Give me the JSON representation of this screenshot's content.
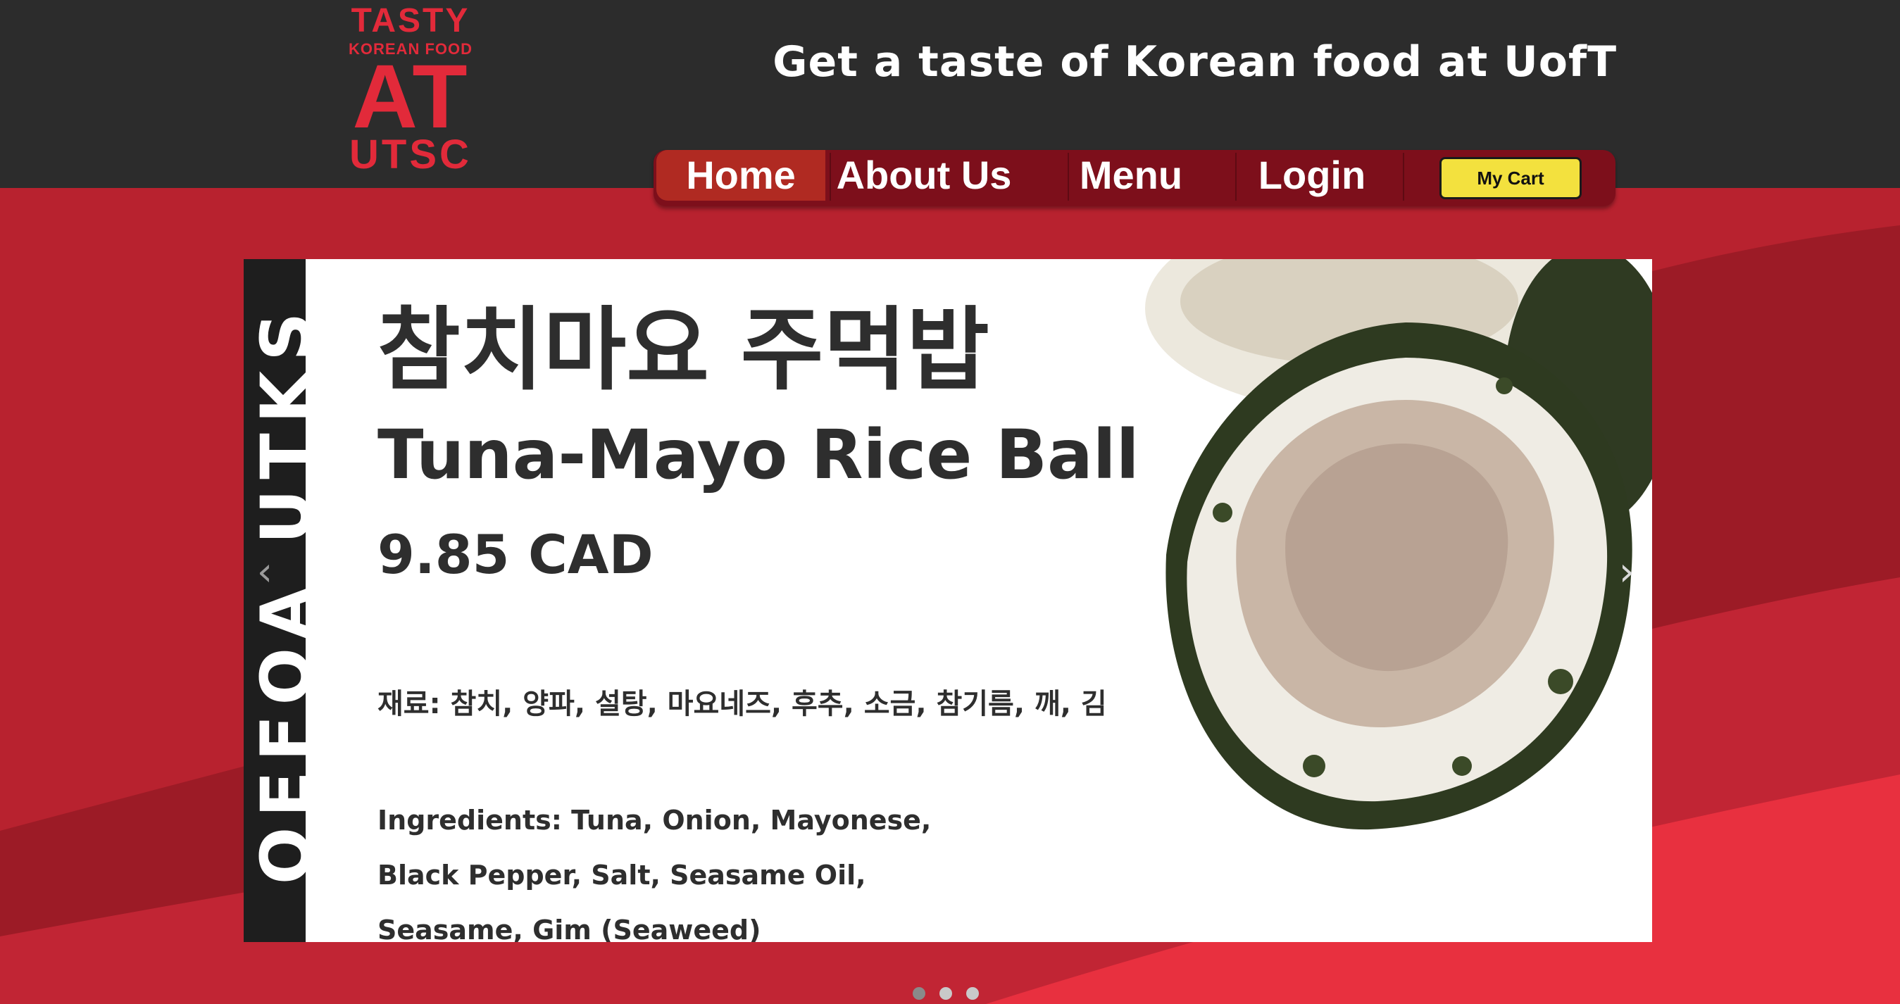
{
  "logo": {
    "line1": "TASTY",
    "line2": "KOREAN FOOD",
    "line3": "AT",
    "line4": "UTSC"
  },
  "header": {
    "tagline": "Get a taste of Korean food at UofT"
  },
  "nav": {
    "items": [
      {
        "label": "Home",
        "active": true
      },
      {
        "label": "About Us"
      },
      {
        "label": "Menu"
      },
      {
        "label": "Login"
      }
    ],
    "cart_label": "My Cart"
  },
  "carousel": {
    "side_text": "OEFOA UTKS",
    "slide": {
      "korean_name": "참치마요 주먹밥",
      "english_name": "Tuna-Mayo Rice Ball",
      "price": "9.85 CAD",
      "korean_ingredients": "재료: 참치, 양파, 설탕, 마요네즈, 후추, 소금, 참기름, 깨, 김",
      "english_ingredients": "Ingredients: Tuna, Onion, Mayonese, Black Pepper, Salt, Seasame Oil, Seasame, Gim (Seaweed)"
    },
    "prev_arrow": "‹",
    "next_arrow": "›",
    "indicator_count": 3,
    "active_indicator": 1
  },
  "colors": {
    "header_bg": "#2c2c2c",
    "brand_red": "#e22a3a",
    "page_red": "#b82230",
    "nav_bg": "#7d0f1b",
    "nav_active": "#b02a22",
    "cart_yellow": "#f3e13e"
  }
}
